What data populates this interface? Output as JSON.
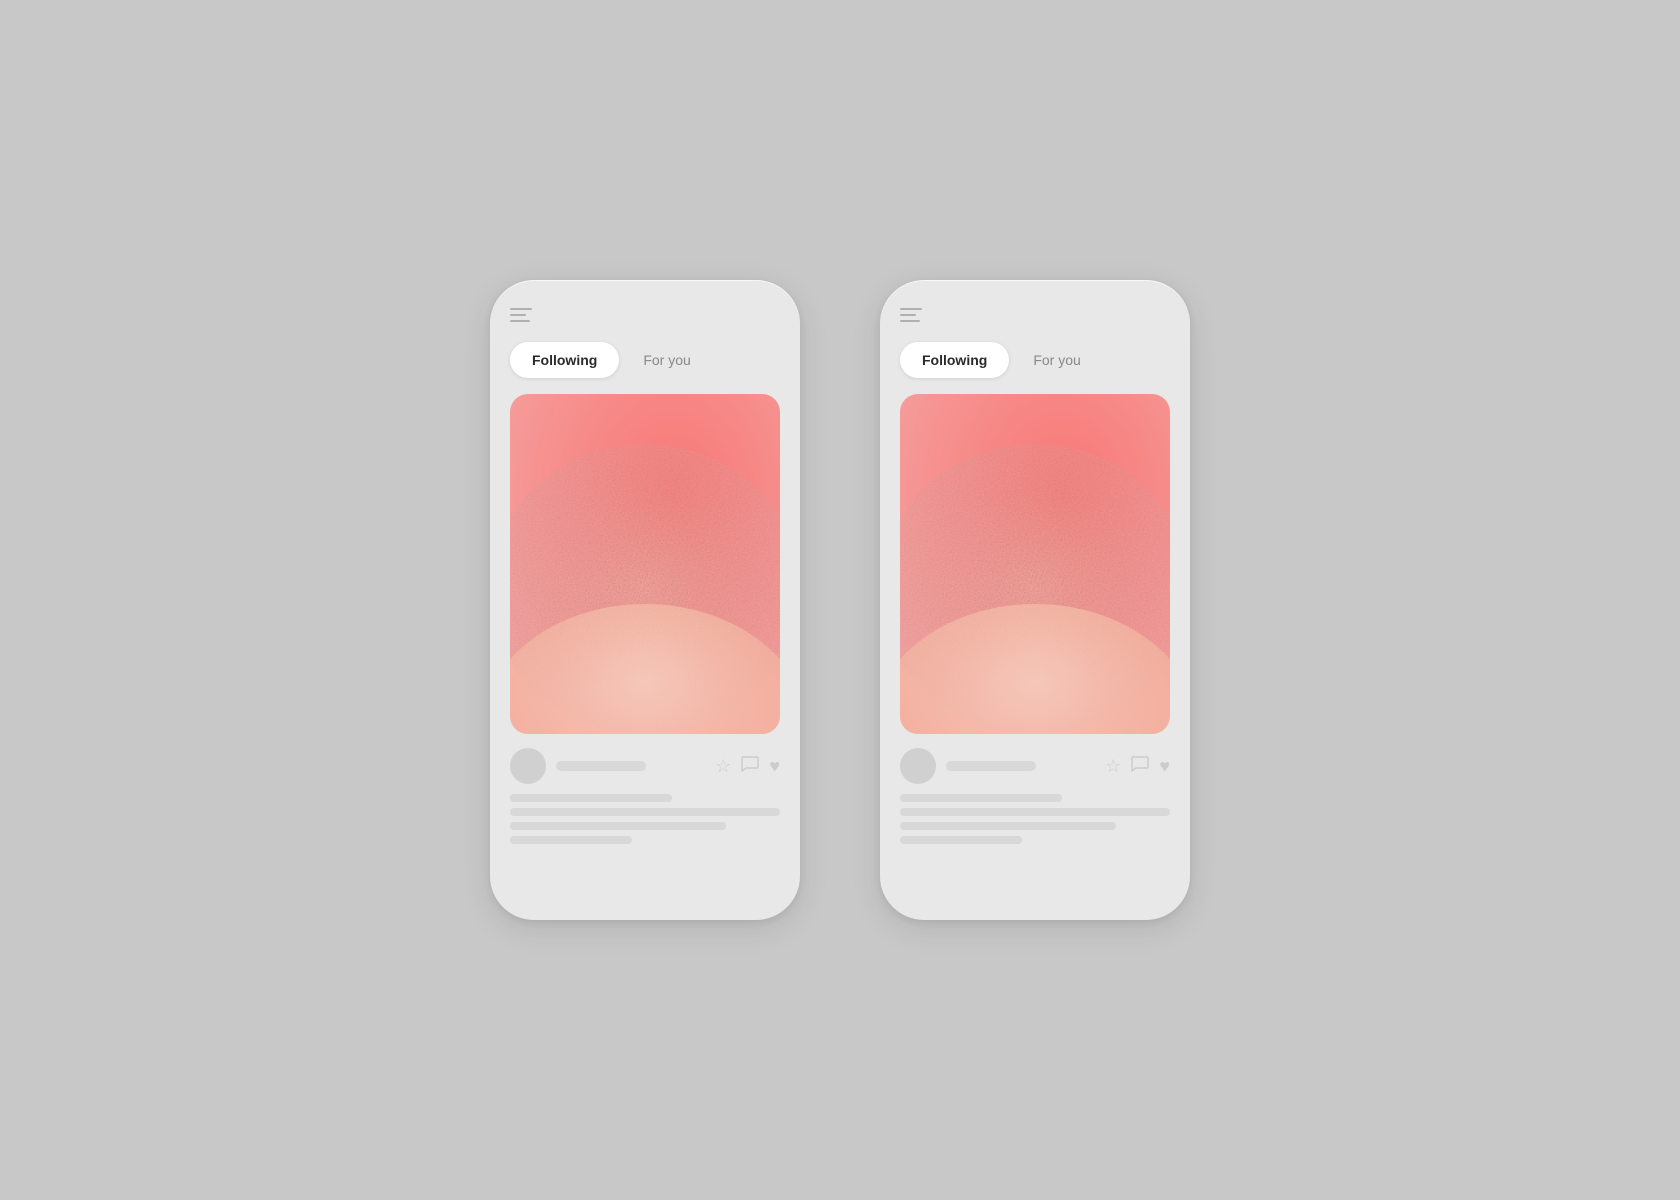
{
  "background": "#c8c8c8",
  "phones": [
    {
      "id": "phone-left",
      "tabs": [
        {
          "label": "Following",
          "active": true
        },
        {
          "label": "For you",
          "active": false
        }
      ]
    },
    {
      "id": "phone-right",
      "tabs": [
        {
          "label": "Following",
          "active": true
        },
        {
          "label": "For you",
          "active": false
        }
      ]
    }
  ],
  "icons": {
    "menu": "menu-icon",
    "star": "★",
    "chat": "💬",
    "heart": "♥"
  }
}
